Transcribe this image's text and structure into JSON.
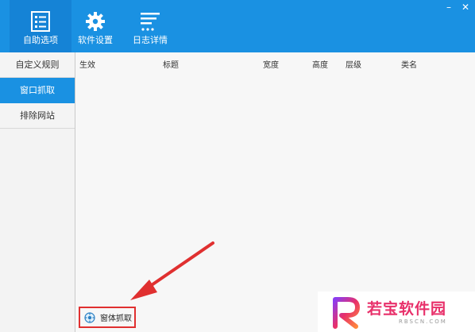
{
  "toolbar": {
    "items": [
      {
        "label": "自助选项",
        "icon": "checklist-icon",
        "active": true
      },
      {
        "label": "软件设置",
        "icon": "gear-icon",
        "active": false
      },
      {
        "label": "日志详情",
        "icon": "log-lines-icon",
        "active": false
      }
    ],
    "close_glyph": "✕",
    "minimize_glyph": "–"
  },
  "sidebar": {
    "items": [
      {
        "label": "自定义规则",
        "selected": false
      },
      {
        "label": "窗口抓取",
        "selected": true
      },
      {
        "label": "排除网站",
        "selected": false
      }
    ]
  },
  "table": {
    "columns": [
      "生效",
      "标题",
      "宽度",
      "高度",
      "层级",
      "类名"
    ]
  },
  "capture_button": {
    "label": "窗体抓取",
    "icon": "crosshair-target-icon"
  },
  "watermark": {
    "brand_cn": "若宝软件园",
    "brand_en": "RBSCN.COM"
  },
  "colors": {
    "accent": "#1a91e2",
    "highlight_border": "#e03030",
    "watermark_pink": "#e8306a"
  }
}
